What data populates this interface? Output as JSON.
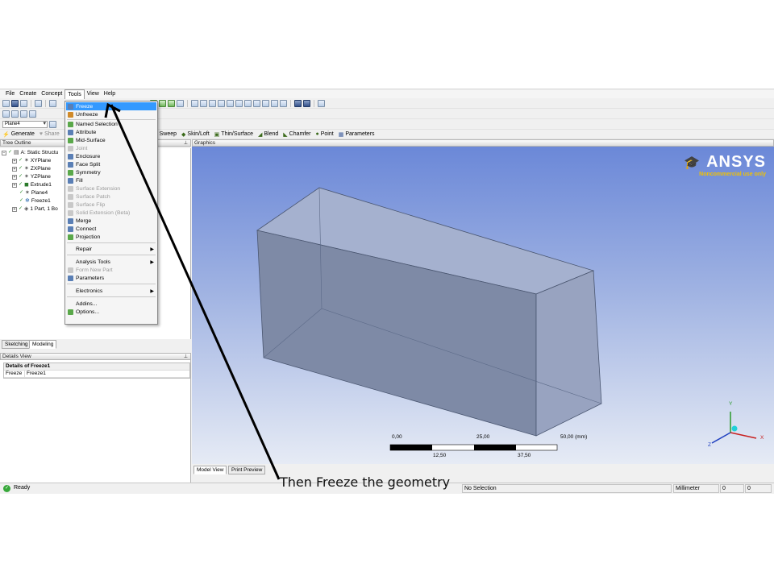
{
  "menubar": {
    "items": [
      "File",
      "Create",
      "Concept",
      "Tools",
      "View",
      "Help"
    ]
  },
  "toolbar": {
    "plane_combo": "Plane4",
    "generate_label": "Generate",
    "share_label": "Share",
    "features": [
      "Sweep",
      "Skin/Loft",
      "Thin/Surface",
      "Blend",
      "Chamfer",
      "Point",
      "Parameters"
    ]
  },
  "tree_outline": {
    "title": "Tree Outline",
    "nodes": [
      "A: Static Structu",
      "XYPlane",
      "ZXPlane",
      "YZPlane",
      "Extrude1",
      "Plane4",
      "Freeze1",
      "1 Part, 1 Bo"
    ]
  },
  "left_tabs": {
    "sketching": "Sketching",
    "modeling": "Modeling"
  },
  "details": {
    "title": "Details View",
    "header": "Details of Freeze1",
    "row_label": "Freeze",
    "row_value": "Freeze1"
  },
  "graphics": {
    "title": "Graphics",
    "logo_text": "ANSYS",
    "logo_subtitle": "Noncommercial use only",
    "scale_top": [
      "0,00",
      "25,00",
      "50,00 (mm)"
    ],
    "scale_bottom": [
      "12,50",
      "37,50"
    ],
    "axes": {
      "y": "Y",
      "x": "X",
      "z": "Z"
    },
    "tabs": [
      "Model View",
      "Print Preview"
    ]
  },
  "tools_menu": {
    "items": [
      {
        "label": "Freeze",
        "state": "highlighted"
      },
      {
        "label": "Unfreeze",
        "state": "normal"
      },
      {
        "label": "Named Selection",
        "state": "normal"
      },
      {
        "label": "Attribute",
        "state": "normal"
      },
      {
        "label": "Mid-Surface",
        "state": "normal"
      },
      {
        "label": "Joint",
        "state": "disabled"
      },
      {
        "label": "Enclosure",
        "state": "normal"
      },
      {
        "label": "Face Split",
        "state": "normal"
      },
      {
        "label": "Symmetry",
        "state": "normal"
      },
      {
        "label": "Fill",
        "state": "normal"
      },
      {
        "label": "Surface Extension",
        "state": "disabled"
      },
      {
        "label": "Surface Patch",
        "state": "disabled"
      },
      {
        "label": "Surface Flip",
        "state": "disabled"
      },
      {
        "label": "Solid Extension (Beta)",
        "state": "disabled"
      },
      {
        "label": "Merge",
        "state": "normal"
      },
      {
        "label": "Connect",
        "state": "normal"
      },
      {
        "label": "Projection",
        "state": "normal"
      },
      {
        "label": "Repair",
        "state": "submenu"
      },
      {
        "label": "Analysis Tools",
        "state": "submenu"
      },
      {
        "label": "Form New Part",
        "state": "disabled"
      },
      {
        "label": "Parameters",
        "state": "normal"
      },
      {
        "label": "Electronics",
        "state": "submenu"
      },
      {
        "label": "Addins...",
        "state": "normal"
      },
      {
        "label": "Options...",
        "state": "normal"
      }
    ]
  },
  "status": {
    "ready": "Ready",
    "selection": "No Selection",
    "units": "Millimeter",
    "coord1": "0",
    "coord2": "0"
  },
  "caption": "Then Freeze the geometry"
}
